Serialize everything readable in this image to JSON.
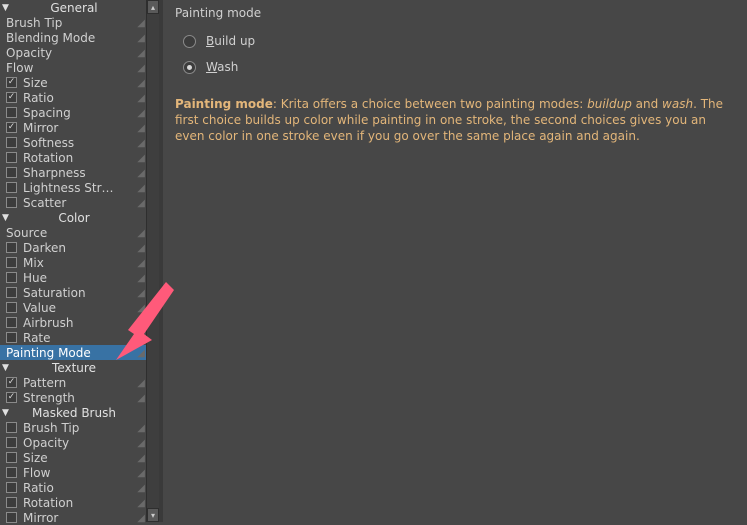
{
  "panel": {
    "title": "Painting mode",
    "radios": [
      {
        "label_pre": "B",
        "label_rest": "uild up",
        "checked": false
      },
      {
        "label_pre": "W",
        "label_rest": "ash",
        "checked": true
      }
    ],
    "desc": {
      "head": "Painting mode",
      "mid1": ": Krita offers a choice between two painting modes: ",
      "it1": "buildup",
      "and": " and ",
      "it2": "wash",
      "tail": ". The first choice builds up color while painting in one stroke, the second choices gives you an even color in one stroke even if you go over the same place again and again."
    }
  },
  "sidebar": {
    "sections": [
      {
        "title": "General",
        "items": [
          {
            "label": "Brush Tip",
            "cb": "none"
          },
          {
            "label": "Blending Mode",
            "cb": "none"
          },
          {
            "label": "Opacity",
            "cb": "none"
          },
          {
            "label": "Flow",
            "cb": "none"
          },
          {
            "label": "Size",
            "checked": true
          },
          {
            "label": "Ratio",
            "checked": true
          },
          {
            "label": "Spacing",
            "checked": false
          },
          {
            "label": "Mirror",
            "checked": true
          },
          {
            "label": "Softness",
            "checked": false
          },
          {
            "label": "Rotation",
            "checked": false
          },
          {
            "label": "Sharpness",
            "checked": false
          },
          {
            "label": "Lightness Str…",
            "checked": false
          },
          {
            "label": "Scatter",
            "checked": false
          }
        ]
      },
      {
        "title": "Color",
        "items": [
          {
            "label": "Source",
            "cb": "none"
          },
          {
            "label": "Darken",
            "checked": false
          },
          {
            "label": "Mix",
            "checked": false
          },
          {
            "label": "Hue",
            "checked": false
          },
          {
            "label": "Saturation",
            "checked": false
          },
          {
            "label": "Value",
            "checked": false
          },
          {
            "label": "Airbrush",
            "checked": false
          },
          {
            "label": "Rate",
            "checked": false
          },
          {
            "label": "Painting Mode",
            "cb": "none",
            "selected": true
          }
        ]
      },
      {
        "title": "Texture",
        "items": [
          {
            "label": "Pattern",
            "checked": true
          },
          {
            "label": "Strength",
            "checked": true
          }
        ]
      },
      {
        "title": "Masked Brush",
        "items": [
          {
            "label": "Brush Tip",
            "checked": false
          },
          {
            "label": "Opacity",
            "checked": false
          },
          {
            "label": "Size",
            "checked": false
          },
          {
            "label": "Flow",
            "checked": false
          },
          {
            "label": "Ratio",
            "checked": false
          },
          {
            "label": "Rotation",
            "checked": false
          },
          {
            "label": "Mirror",
            "checked": false
          }
        ]
      }
    ]
  }
}
